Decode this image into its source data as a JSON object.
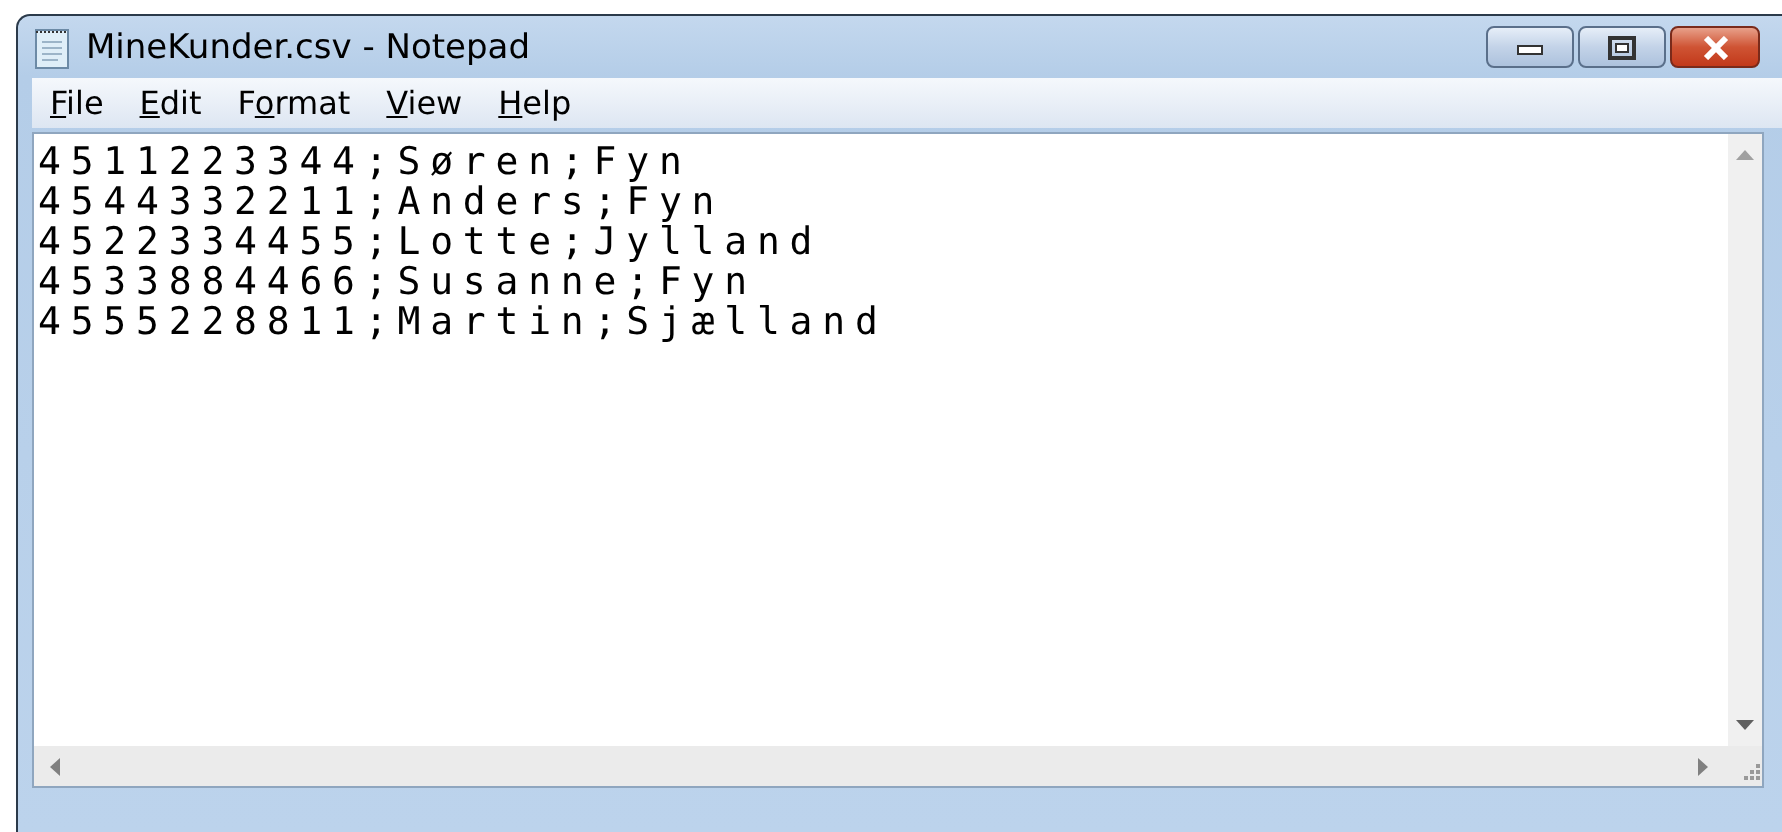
{
  "window": {
    "title": "MineKunder.csv - Notepad"
  },
  "menu": [
    {
      "access_key": "F",
      "label_rest": "ile"
    },
    {
      "access_key": "E",
      "label_rest": "dit"
    },
    {
      "label_start": "F",
      "access_key": "o",
      "label_rest": "rmat"
    },
    {
      "access_key": "V",
      "label_rest": "iew"
    },
    {
      "access_key": "H",
      "label_rest": "elp"
    }
  ],
  "editor": {
    "lines": [
      "4511223344;Søren;Fyn",
      "4544332211;Anders;Fyn",
      "4522334455;Lotte;Jylland",
      "4533884466;Susanne;Fyn",
      "4555228811;Martin;Sjælland"
    ]
  }
}
